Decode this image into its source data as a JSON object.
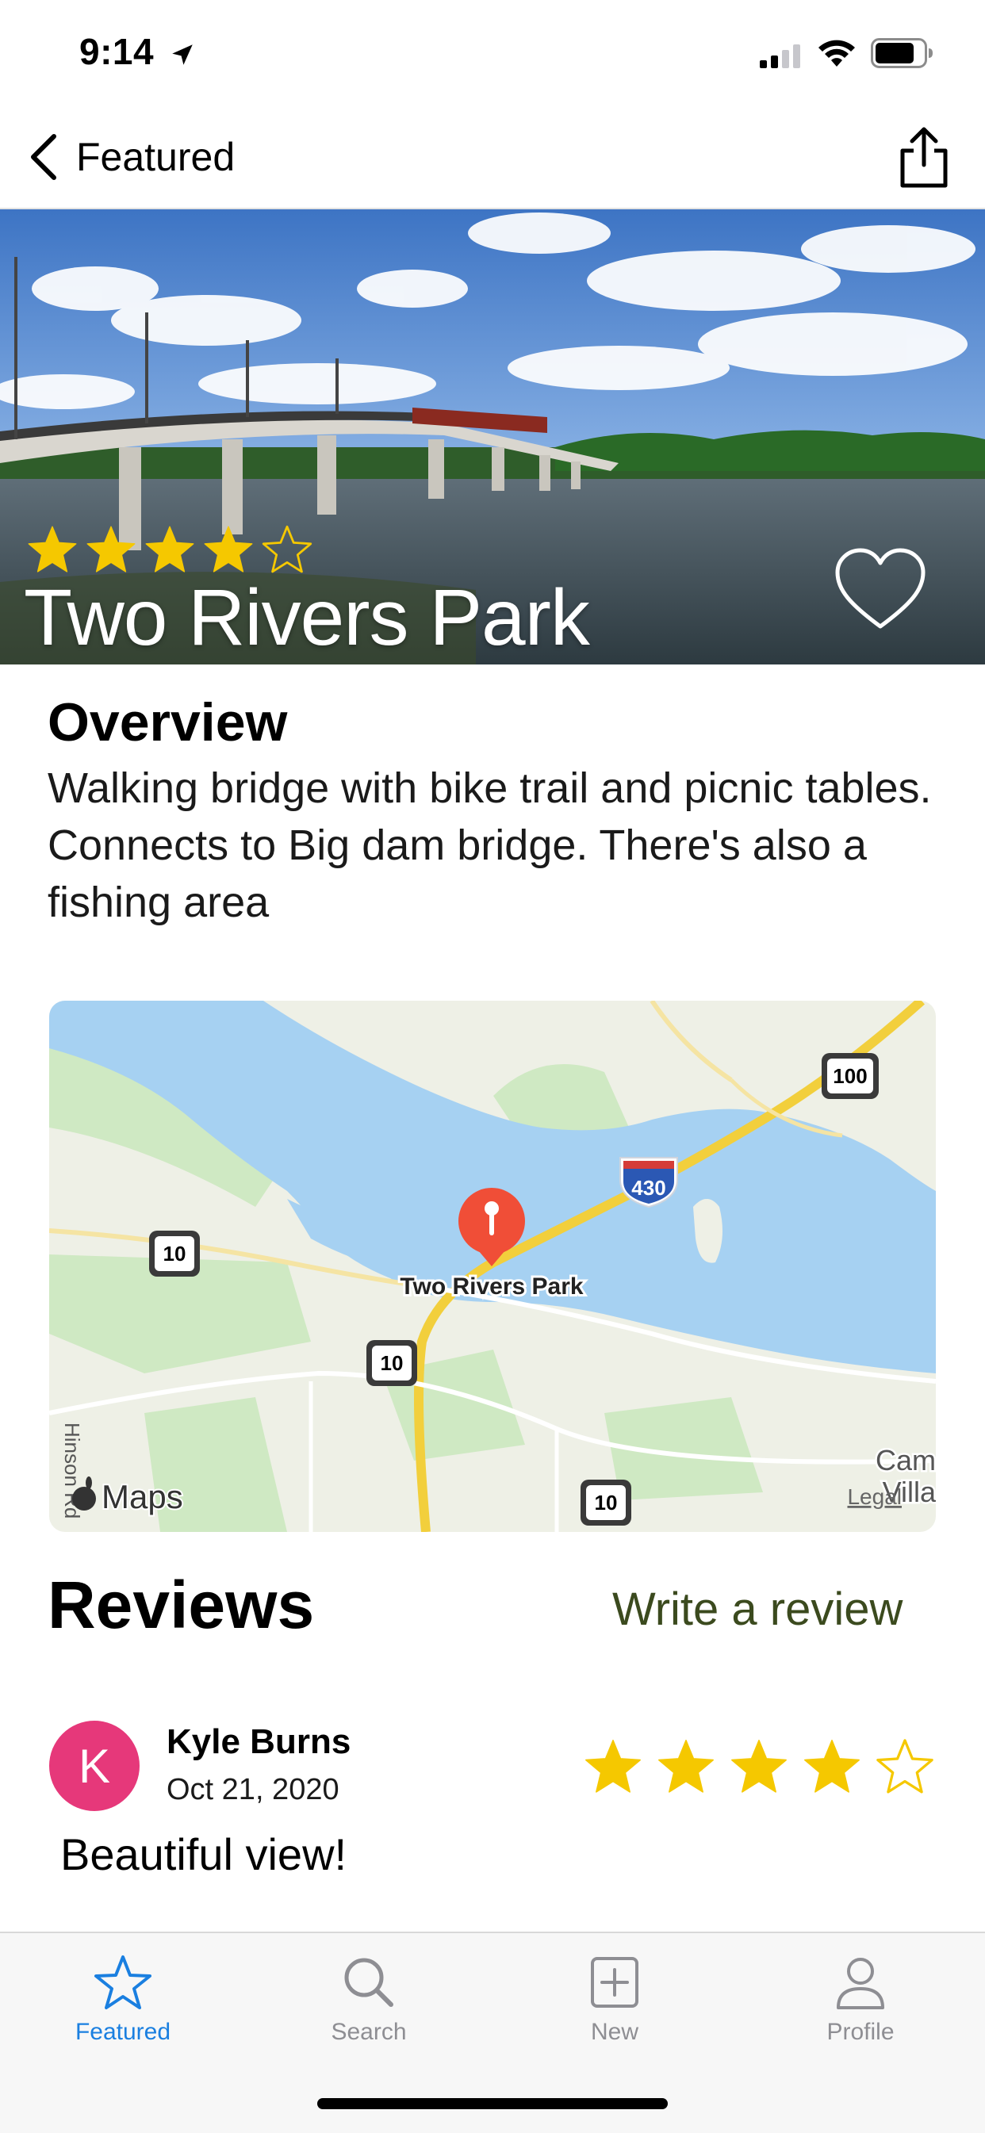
{
  "status_bar": {
    "time": "9:14"
  },
  "nav": {
    "back_label": "Featured"
  },
  "park": {
    "name": "Two Rivers Park",
    "rating": 4,
    "rating_max": 5
  },
  "overview": {
    "title": "Overview",
    "text": "Walking bridge with bike trail and picnic tables. Connects to Big dam bridge. There's also a fishing area"
  },
  "map": {
    "pin_label": "Two Rivers Park",
    "attribution": "Maps",
    "legal": "Legal",
    "shields": [
      "100",
      "430",
      "10",
      "10",
      "10"
    ],
    "edge_labels": [
      "Hinson Rd",
      "Cam",
      "Villa"
    ]
  },
  "reviews": {
    "title": "Reviews",
    "write_label": "Write a review",
    "items": [
      {
        "initial": "K",
        "name": "Kyle Burns",
        "date": "Oct 21, 2020",
        "rating": 4,
        "rating_max": 5,
        "text": "Beautiful view!"
      }
    ]
  },
  "tabs": [
    {
      "label": "Featured",
      "icon": "star-icon",
      "active": true
    },
    {
      "label": "Search",
      "icon": "search-icon",
      "active": false
    },
    {
      "label": "New",
      "icon": "plus-square-icon",
      "active": false
    },
    {
      "label": "Profile",
      "icon": "person-icon",
      "active": false
    }
  ],
  "colors": {
    "star": "#F5C800",
    "accent": "#1A7FE0",
    "avatar": "#E6387A",
    "write_review": "#3B4A1E",
    "pin": "#F04E37"
  }
}
